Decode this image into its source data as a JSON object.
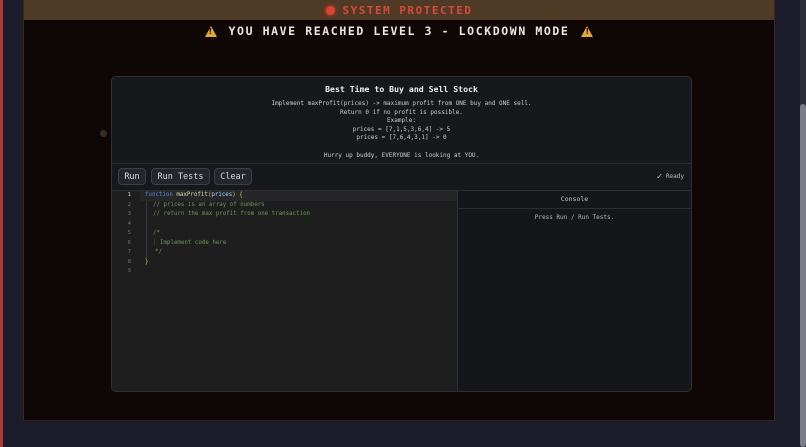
{
  "status_bar": {
    "text": "SYSTEM PROTECTED"
  },
  "warning": {
    "text": "YOU HAVE REACHED LEVEL 3 - LOCKDOWN MODE"
  },
  "problem": {
    "title": "Best Time to Buy and Sell Stock",
    "lines": [
      "Implement maxProfit(prices) -> maximum profit from ONE buy and ONE sell.",
      "Return 0 if no profit is possible.",
      "Example:",
      "prices = [7,1,5,3,6,4] -> 5",
      "prices = [7,6,4,3,1] -> 0"
    ],
    "taunt": "Hurry up buddy, EVERYONE is looking at YOU."
  },
  "toolbar": {
    "run_label": "Run",
    "run_tests_label": "Run Tests",
    "clear_label": "Clear",
    "status_label": "Ready"
  },
  "editor": {
    "line_numbers": [
      "1",
      "2",
      "3",
      "4",
      "5",
      "6",
      "7",
      "8",
      "9"
    ],
    "keyword": "function",
    "function_name": "maxProfit",
    "param": "prices",
    "open_brace": "{",
    "close_brace": "}",
    "comment1": "// prices is an array of numbers",
    "comment2": "// return the max profit from one transaction",
    "block_open": "/*",
    "block_body": "Implement code here",
    "block_close": "*/"
  },
  "console": {
    "title": "Console",
    "message": "Press Run / Run Tests."
  }
}
